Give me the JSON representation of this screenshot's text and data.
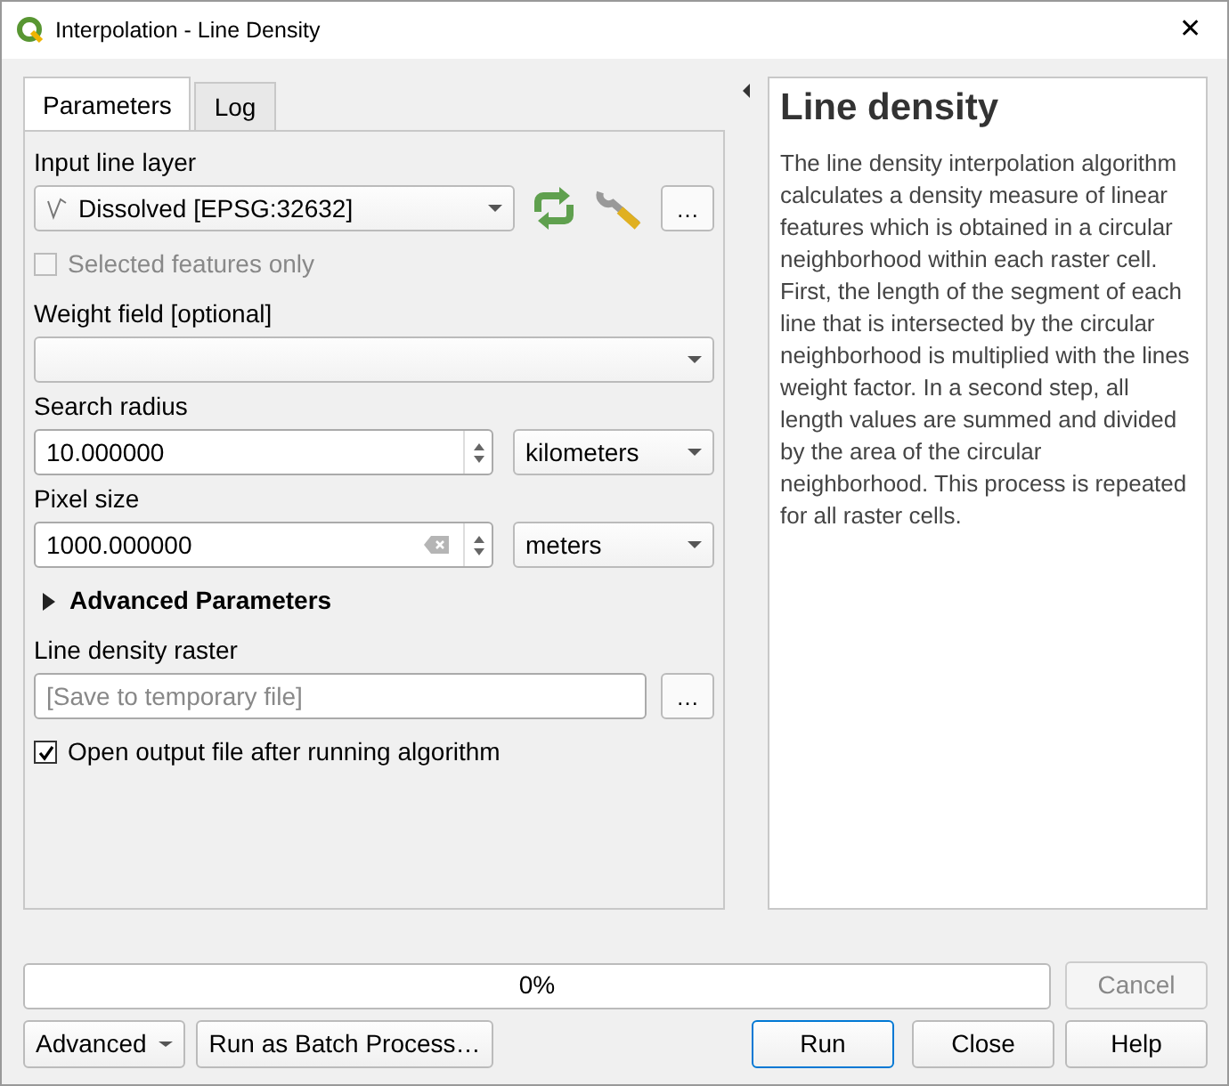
{
  "window": {
    "title": "Interpolation - Line Density",
    "close": "✕"
  },
  "tabs": [
    {
      "label": "Parameters",
      "selected": true
    },
    {
      "label": "Log",
      "selected": false
    }
  ],
  "input_layer": {
    "label": "Input line layer",
    "value": "Dissolved [EPSG:32632]",
    "more": "…"
  },
  "selected_only": {
    "label": "Selected features only",
    "checked": false,
    "disabled": true
  },
  "weight_field": {
    "label": "Weight field  [optional]"
  },
  "search_radius": {
    "label": "Search radius",
    "value": "10.000000",
    "unit": "kilometers"
  },
  "pixel_size": {
    "label": "Pixel size",
    "value": "1000.000000",
    "unit": "meters"
  },
  "advanced_parameters": {
    "label": "Advanced Parameters",
    "expanded": false
  },
  "output": {
    "label": "Line density raster",
    "placeholder": "[Save to temporary file]",
    "more": "…"
  },
  "open_output": {
    "label": "Open output file after running algorithm",
    "checked": true
  },
  "help": {
    "title": "Line density",
    "text": "The line density interpolation algorithm calculates a density measure of linear features which is obtained in a circular neighborhood within each raster cell. First, the length of the segment of each line that is intersected by the circular neighborhood is multiplied with the lines weight factor. In a second step, all length values are summed and divided by the area of the circular neighborhood. This process is repeated for all raster cells."
  },
  "progress": {
    "text": "0%",
    "level": 0
  },
  "buttons": [
    {
      "label": "Cancel",
      "kind": "cancel",
      "disabled": true
    },
    {
      "label": "Advanced",
      "kind": "menu",
      "disabled": false
    },
    {
      "label": "Run as Batch Process…",
      "kind": "left",
      "disabled": false
    },
    {
      "label": "Run",
      "kind": "default",
      "disabled": false
    },
    {
      "label": "Close",
      "kind": "right",
      "disabled": false
    },
    {
      "label": "Help",
      "kind": "right",
      "disabled": false
    }
  ]
}
